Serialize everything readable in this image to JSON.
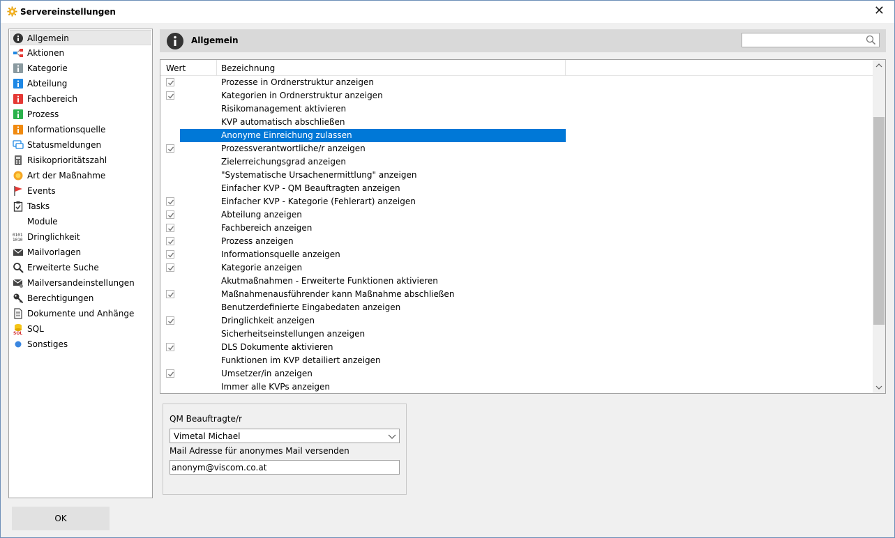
{
  "window": {
    "title": "Servereinstellungen"
  },
  "sidebar": {
    "items": [
      {
        "label": "Allgemein",
        "icon": "info-black-icon",
        "selected": true
      },
      {
        "label": "Aktionen",
        "icon": "actions-icon"
      },
      {
        "label": "Kategorie",
        "icon": "info-gray-icon"
      },
      {
        "label": "Abteilung",
        "icon": "info-blue-icon"
      },
      {
        "label": "Fachbereich",
        "icon": "info-red-icon"
      },
      {
        "label": "Prozess",
        "icon": "info-green-icon"
      },
      {
        "label": "Informationsquelle",
        "icon": "info-orange-icon"
      },
      {
        "label": "Statusmeldungen",
        "icon": "chat-icon"
      },
      {
        "label": "Risikoprioritätszahl",
        "icon": "calculator-icon"
      },
      {
        "label": "Art der Maßnahme",
        "icon": "sun-icon"
      },
      {
        "label": "Events",
        "icon": "flag-icon"
      },
      {
        "label": "Tasks",
        "icon": "clipboard-check-icon"
      },
      {
        "label": "Module",
        "icon": ""
      },
      {
        "label": "Dringlichkeit",
        "icon": "binary-icon"
      },
      {
        "label": "Mailvorlagen",
        "icon": "mail-icon"
      },
      {
        "label": "Erweiterte Suche",
        "icon": "magnifier-icon"
      },
      {
        "label": "Mailversandeinstellungen",
        "icon": "mail-settings-icon"
      },
      {
        "label": "Berechtigungen",
        "icon": "key-icon"
      },
      {
        "label": "Dokumente und Anhänge",
        "icon": "document-icon"
      },
      {
        "label": "SQL",
        "icon": "database-sql-icon"
      },
      {
        "label": "Sonstiges",
        "icon": "blue-dot-icon"
      }
    ]
  },
  "header": {
    "title": "Allgemein",
    "search_value": ""
  },
  "grid": {
    "columns": {
      "wert": "Wert",
      "bezeichnung": "Bezeichnung"
    },
    "rows": [
      {
        "checked": true,
        "label": "Prozesse in Ordnerstruktur anzeigen"
      },
      {
        "checked": true,
        "label": "Kategorien in Ordnerstruktur anzeigen"
      },
      {
        "checked": false,
        "label": "Risikomanagement aktivieren"
      },
      {
        "checked": false,
        "label": "KVP automatisch abschließen"
      },
      {
        "checked": false,
        "label": "Anonyme Einreichung zulassen",
        "selected": true
      },
      {
        "checked": true,
        "label": "Prozessverantwortliche/r anzeigen"
      },
      {
        "checked": false,
        "label": "Zielerreichungsgrad anzeigen"
      },
      {
        "checked": false,
        "label": "\"Systematische Ursachenermittlung\" anzeigen"
      },
      {
        "checked": false,
        "label": "Einfacher KVP - QM Beauftragten anzeigen"
      },
      {
        "checked": true,
        "label": "Einfacher KVP - Kategorie (Fehlerart) anzeigen"
      },
      {
        "checked": true,
        "label": "Abteilung anzeigen"
      },
      {
        "checked": true,
        "label": "Fachbereich anzeigen"
      },
      {
        "checked": true,
        "label": "Prozess anzeigen"
      },
      {
        "checked": true,
        "label": "Informationsquelle anzeigen"
      },
      {
        "checked": true,
        "label": "Kategorie anzeigen"
      },
      {
        "checked": false,
        "label": "Akutmaßnahmen - Erweiterte Funktionen aktivieren"
      },
      {
        "checked": true,
        "label": "Maßnahmenausführender kann Maßnahme abschließen"
      },
      {
        "checked": false,
        "label": "Benutzerdefinierte Eingabedaten anzeigen"
      },
      {
        "checked": true,
        "label": "Dringlichkeit anzeigen"
      },
      {
        "checked": false,
        "label": "Sicherheitseinstellungen anzeigen"
      },
      {
        "checked": true,
        "label": "DLS Dokumente aktivieren"
      },
      {
        "checked": false,
        "label": "Funktionen im KVP detailiert anzeigen"
      },
      {
        "checked": true,
        "label": "Umsetzer/in anzeigen"
      },
      {
        "checked": false,
        "label": "Immer alle KVPs anzeigen"
      }
    ]
  },
  "details": {
    "qm_label": "QM Beauftragte/r",
    "qm_value": "Vimetal Michael",
    "mail_label": "Mail Adresse für anonymes Mail versenden",
    "mail_value": "anonym@viscom.co.at"
  },
  "buttons": {
    "ok": "OK"
  },
  "colors": {
    "selection": "#0078d7",
    "header_bg": "#d9d9d9"
  }
}
